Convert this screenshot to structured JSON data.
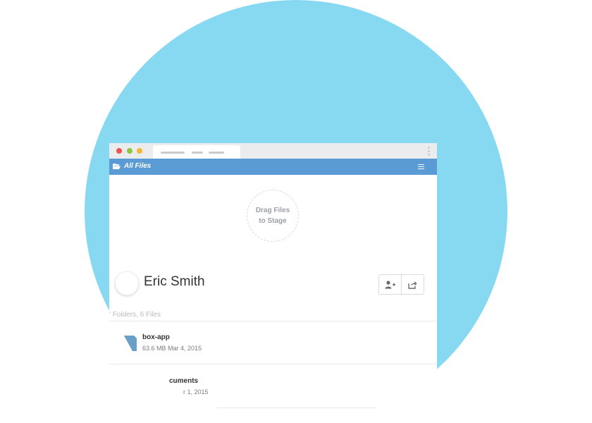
{
  "header": {
    "app_title": "All Files"
  },
  "dropzone": {
    "line1": "Drag Files",
    "line2": "to Stage"
  },
  "user": {
    "name": "Eric Smith"
  },
  "summary": {
    "text": "' Folders, 6 Files"
  },
  "files": [
    {
      "name": "box-app",
      "meta": "63.6 MB  Mar 4, 2015"
    },
    {
      "name": "cuments",
      "meta": "r 1, 2015"
    }
  ],
  "icons": {
    "folder": "folder-open-icon",
    "menu": "hamburger-menu-icon",
    "add_user": "add-user-icon",
    "share": "share-icon"
  },
  "colors": {
    "accent": "#5b9bd5",
    "background_circle": "#87d9f2",
    "chrome": "#ebeced"
  }
}
